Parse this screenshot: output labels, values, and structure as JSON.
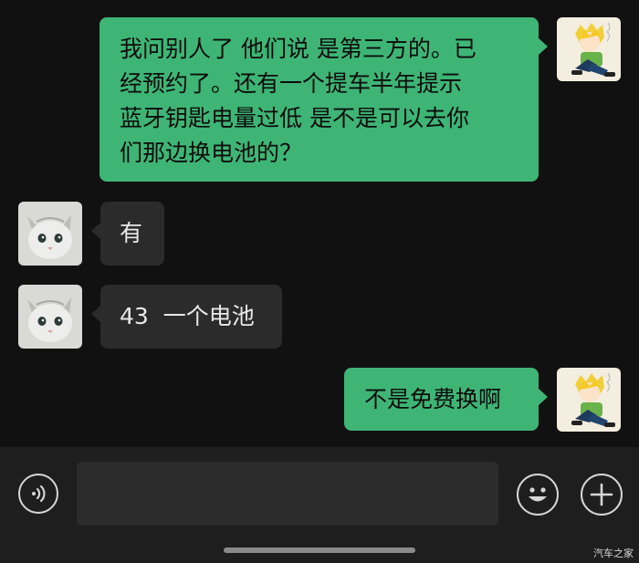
{
  "messages": [
    {
      "sender": "me",
      "text": "我问别人了 他们说 是第三方的。已\n经预约了。还有一个提车半年提示\n蓝牙钥匙电量过低 是不是可以去你\n们那边换电池的？"
    },
    {
      "sender": "other",
      "text": "有"
    },
    {
      "sender": "other",
      "text": "43  一个电池"
    },
    {
      "sender": "me",
      "text": "不是免费换啊"
    }
  ],
  "input_bar": {
    "voice_icon": "voice-icon",
    "emoji_icon": "emoji-icon",
    "plus_icon": "plus-icon",
    "text_value": ""
  },
  "watermark": "汽车之家",
  "colors": {
    "outgoing_bubble": "#3eb575",
    "incoming_bubble": "#2b2b2b",
    "background": "#111111",
    "input_bar": "#1e1e1e"
  }
}
